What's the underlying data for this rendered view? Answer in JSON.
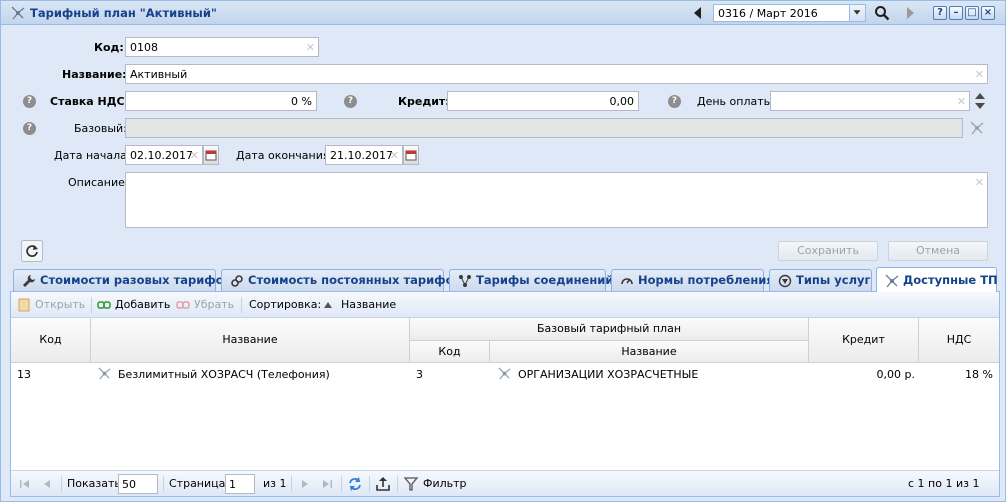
{
  "window": {
    "title": "Тарифный план \"Активный\"",
    "period": "0316 / Март 2016",
    "tools": {
      "help": "?",
      "minimize": "–",
      "maximize": "□",
      "close": "×"
    }
  },
  "form": {
    "code_label": "Код:",
    "code_value": "0108",
    "name_label": "Название:",
    "name_value": "Активный",
    "vat_label": "Ставка НДС:",
    "vat_value": "0 %",
    "credit_label": "Кредит:",
    "credit_value": "0,00",
    "payday_label": "День оплаты:",
    "payday_value": "",
    "base_label": "Базовый:",
    "base_value": "",
    "start_label": "Дата начала:",
    "start_value": "02.10.2017",
    "end_label": "Дата окончания:",
    "end_value": "21.10.2017",
    "desc_label": "Описание:",
    "desc_value": ""
  },
  "buttons": {
    "save": "Сохранить",
    "cancel": "Отмена"
  },
  "tabs": [
    {
      "label": "Стоимости разовых тарифов",
      "icon": "wrench-icon"
    },
    {
      "label": "Стоимость постоянных тарифов",
      "icon": "link-icon"
    },
    {
      "label": "Тарифы соединений",
      "icon": "network-icon"
    },
    {
      "label": "Нормы потребления",
      "icon": "gauge-icon"
    },
    {
      "label": "Типы услуг",
      "icon": "service-icon"
    },
    {
      "label": "Доступные ТП",
      "icon": "tariff-icon",
      "active": true
    }
  ],
  "toolbar": {
    "open": "Открыть",
    "add": "Добавить",
    "remove": "Убрать",
    "sort_label": "Сортировка:",
    "sort_field": "Название"
  },
  "grid": {
    "columns": {
      "code": "Код",
      "name": "Название",
      "base_group": "Базовый тарифный план",
      "base_code": "Код",
      "base_name": "Название",
      "credit": "Кредит",
      "vat": "НДС"
    },
    "rows": [
      {
        "code": "13",
        "name": "Безлимитный ХОЗРАСЧ (Телефония)",
        "base_code": "3",
        "base_name": "ОРГАНИЗАЦИИ ХОЗРАСЧЕТНЫЕ",
        "credit": "0,00 р.",
        "vat": "18 %"
      }
    ]
  },
  "pager": {
    "show_label": "Показать",
    "page_size": "50",
    "page_label": "Страница",
    "page": "1",
    "of_label": "из 1",
    "filter_label": "Фильтр",
    "summary": "с 1 по 1 из 1"
  }
}
